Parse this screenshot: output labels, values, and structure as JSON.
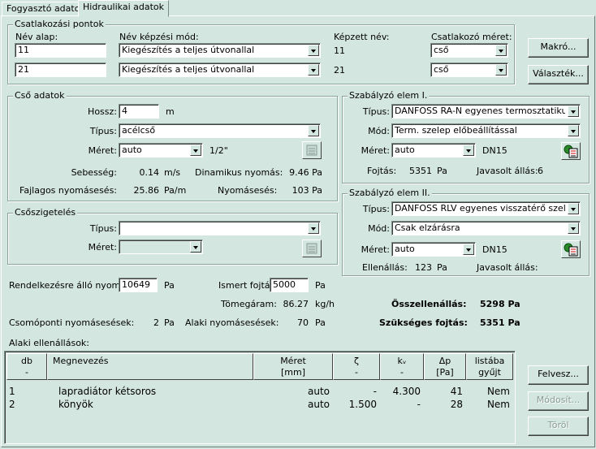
{
  "tabs": [
    {
      "label": "Fogyasztó adatok"
    },
    {
      "label": "Hidraulikai adatok"
    }
  ],
  "csatlakozasi": {
    "title": "Csatlakozási pontok",
    "col_nev_alap": "Név alap:",
    "col_nev_mod": "Név képzési mód:",
    "col_kepzett": "Képzett név:",
    "col_meret": "Csatlakozó méret:",
    "rows": [
      {
        "nev_alap": "11",
        "mod": "Kiegészítés a teljes útvonallal",
        "kepzett": "11",
        "meret": "cső"
      },
      {
        "nev_alap": "21",
        "mod": "Kiegészítés a teljes útvonallal",
        "kepzett": "21",
        "meret": "cső"
      }
    ]
  },
  "buttons": {
    "makro": "Makró...",
    "valasztek": "Választék...",
    "felvesz": "Felvesz...",
    "modosit": "Módosít...",
    "torol": "Töröl"
  },
  "cso": {
    "title": "Cső adatok",
    "hossz_label": "Hossz:",
    "hossz_value": "4",
    "hossz_unit": "m",
    "tipus_label": "Típus:",
    "tipus_value": "acélcső",
    "meret_label": "Méret:",
    "meret_value": "auto",
    "meret_extra": "1/2\"",
    "sebesseg_label": "Sebesség:",
    "sebesseg_value": "0.14",
    "sebesseg_unit": "m/s",
    "dinamikus_label": "Dinamikus nyomás:",
    "dinamikus_value": "9.46 Pa",
    "fajlagos_label": "Fajlagos nyomásesés:",
    "fajlagos_value": "25.86",
    "fajlagos_unit": "Pa/m",
    "nyomases_label": "Nyomásesés:",
    "nyomases_value": "103 Pa"
  },
  "szigeteles": {
    "title": "Csőszigetelés",
    "tipus_label": "Típus:",
    "tipus_value": "",
    "meret_label": "Méret:",
    "meret_value": ""
  },
  "szab1": {
    "title": "Szabályzó elem I.",
    "tipus_label": "Típus:",
    "tipus_value": "DANFOSS RA-N egyenes termosztatikus szel",
    "mod_label": "Mód:",
    "mod_value": "Term. szelep előbeállítással",
    "meret_label": "Méret:",
    "meret_value": "auto",
    "meret_extra": "DN15",
    "fojtas_label": "Fojtás:",
    "fojtas_value": "5351",
    "fojtas_unit": "Pa",
    "javasolt_label": "Javasolt állás:",
    "javasolt_value": "6"
  },
  "szab2": {
    "title": "Szabályzó elem II.",
    "tipus_label": "Típus:",
    "tipus_value": "DANFOSS RLV egyenes visszatérő szelep",
    "mod_label": "Mód:",
    "mod_value": "Csak elzárásra",
    "meret_label": "Méret:",
    "meret_value": "auto",
    "meret_extra": "DN15",
    "ellenallas_label": "Ellenállás:",
    "ellenallas_value": "123",
    "ellenallas_unit": "Pa",
    "javasolt_label": "Javasolt állás:",
    "javasolt_value": ""
  },
  "bottom": {
    "rendelkezesre_label": "Rendelkezésre álló nyomás:",
    "rendelkezesre_value": "10649",
    "rendelkezesre_unit": "Pa",
    "ismert_label": "Ismert fojtás:",
    "ismert_value": "5000",
    "ismert_unit": "Pa",
    "tomegaram_label": "Tömegáram:",
    "tomegaram_value": "86.27",
    "tomegaram_unit": "kg/h",
    "ossz_label": "Összellenállás:",
    "ossz_value": "5298 Pa",
    "csomoponti_label": "Csomóponti nyomásesések:",
    "csomoponti_value": "2",
    "csomoponti_unit": "Pa",
    "alaki_label": "Alaki nyomásesések:",
    "alaki_value": "70",
    "alaki_unit": "Pa",
    "szukseges_label": "Szükséges fojtás:",
    "szukseges_value": "5351 Pa"
  },
  "alaki": {
    "title": "Alaki ellenállások:",
    "headers": [
      {
        "top": "db",
        "sub": "-"
      },
      {
        "top": "Megnevezés",
        "sub": ""
      },
      {
        "top": "Méret",
        "sub": "[mm]"
      },
      {
        "top": "ζ",
        "sub": "-"
      },
      {
        "top": "kᵥ",
        "sub": "-"
      },
      {
        "top": "Δp",
        "sub": "[Pa]"
      },
      {
        "top": "listába",
        "sub": "gyűjt"
      }
    ],
    "rows": [
      {
        "db": "1",
        "nev": "lapradiátor kétsoros",
        "meret": "auto",
        "zeta": "-",
        "kv": "4.300",
        "dp": "41",
        "lista": "Nem"
      },
      {
        "db": "2",
        "nev": "könyök",
        "meret": "auto",
        "zeta": "1.500",
        "kv": "-",
        "dp": "28",
        "lista": "Nem"
      }
    ]
  }
}
